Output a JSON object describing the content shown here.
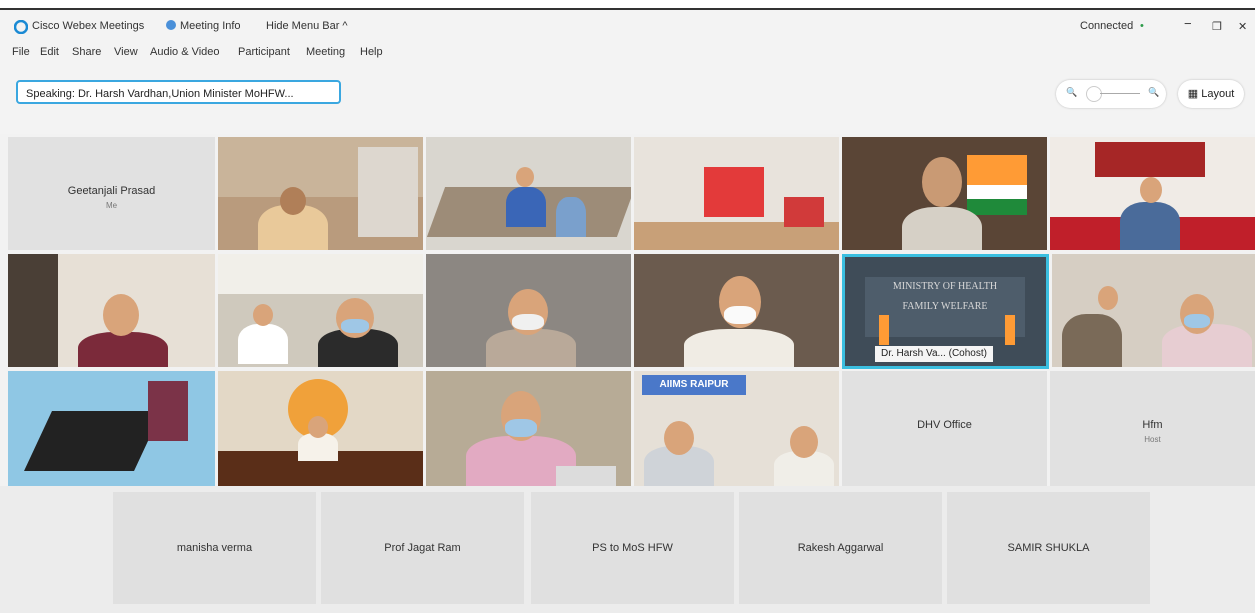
{
  "window": {
    "app_title": "Cisco Webex Meetings",
    "meeting_info": "Meeting Info",
    "hide_menu": "Hide Menu Bar ^",
    "status": "Connected",
    "status_dot": "•",
    "minimize": "−",
    "restore": "❐",
    "close": "✕"
  },
  "menu": [
    "File",
    "Edit",
    "Share",
    "View",
    "Audio & Video",
    "Participant",
    "Meeting",
    "Help"
  ],
  "toolbar": {
    "speaking": "Speaking: Dr. Harsh Vardhan,Union Minister MoHFW...",
    "zoom_out_icon": "🔍",
    "zoom_in_icon": "🔍",
    "layout": "Layout",
    "layout_icon": "▦"
  },
  "tiles": {
    "geetanjali": {
      "name": "Geetanjali Prasad",
      "sub": "Me"
    },
    "active_speaker": "Dr. Harsh Va... (Cohost)",
    "aiims_sign": "AIIMS RAIPUR",
    "ministry_sign_1": "MINISTRY OF HEALTH",
    "ministry_sign_2": "FAMILY WELFARE",
    "dhv": {
      "name": "DHV Office"
    },
    "hfm": {
      "name": "Hfm",
      "sub": "Host"
    }
  },
  "bottom": [
    "manisha verma",
    "Prof Jagat Ram",
    "PS to MoS HFW",
    "Rakesh Aggarwal",
    "SAMIR SHUKLA"
  ],
  "colors": {
    "accent": "#3aa7e0",
    "status": "#2e9b4a"
  }
}
